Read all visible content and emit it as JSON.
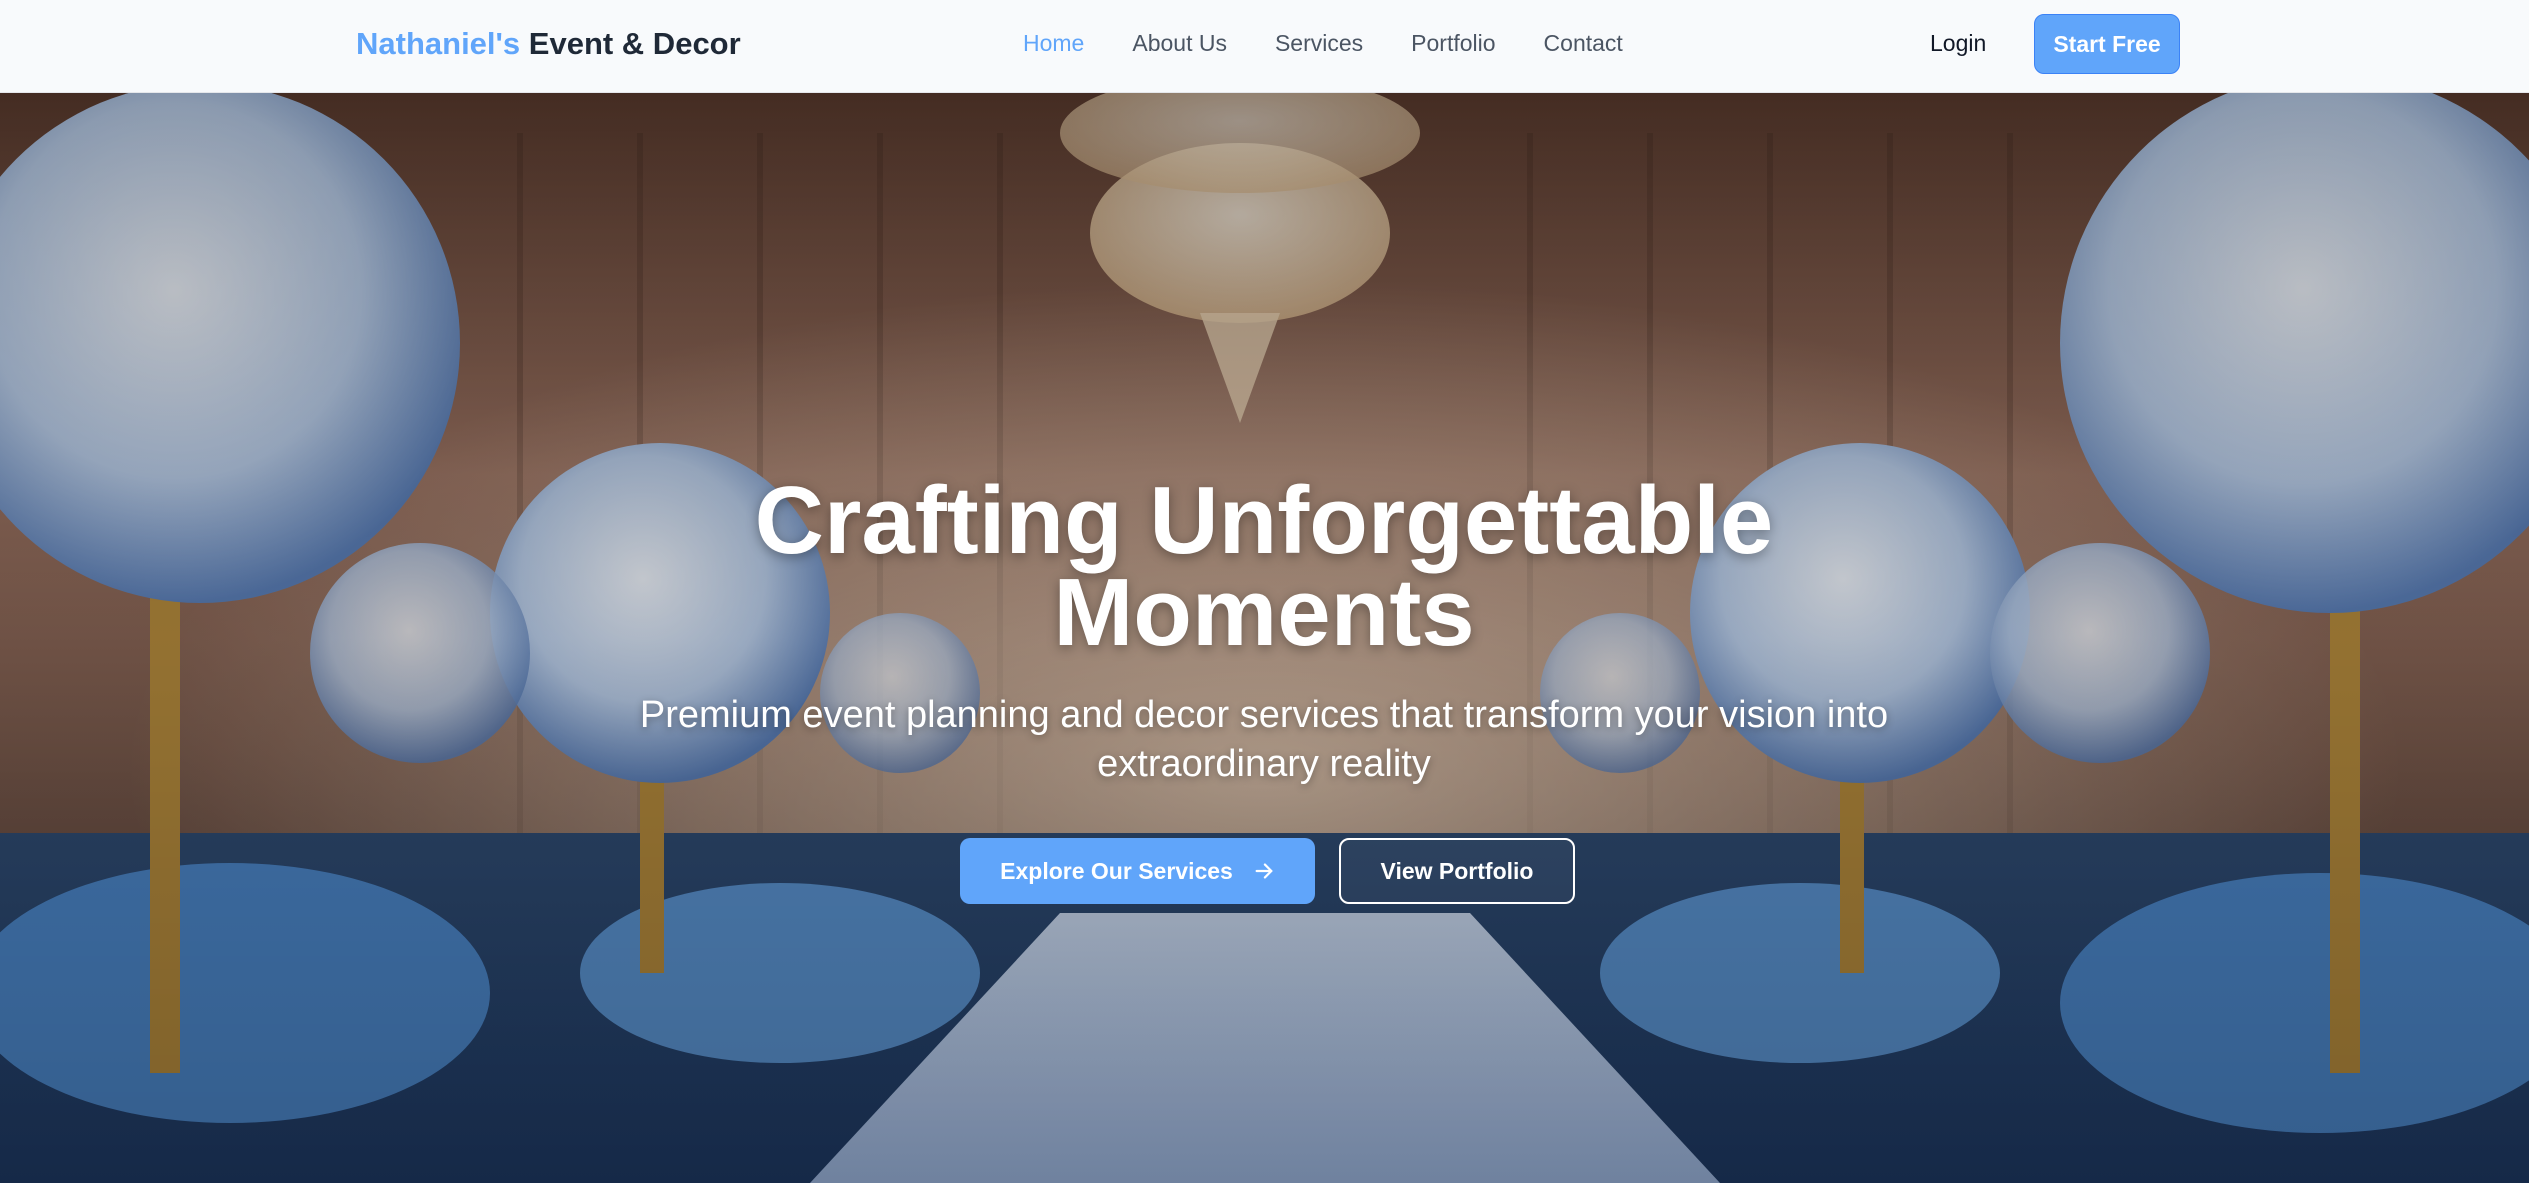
{
  "navbar": {
    "brand_accent": "Nathaniel's",
    "brand_rest": "Event & Decor",
    "links": [
      {
        "label": "Home",
        "active": true
      },
      {
        "label": "About Us"
      },
      {
        "label": "Services"
      },
      {
        "label": "Portfolio"
      },
      {
        "label": "Contact"
      }
    ],
    "login_label": "Login",
    "start_label": "Start Free"
  },
  "hero": {
    "title": "Crafting Unforgettable Moments",
    "subtitle": "Premium event planning and decor services that transform your vision into extraordinary reality",
    "primary_cta": "Explore Our Services",
    "primary_cta_icon": "arrow-right-icon",
    "secondary_cta": "View Portfolio"
  },
  "colors": {
    "accent": "#60a5fa",
    "nav_bg": "#f8fafc",
    "nav_text": "#4b5563",
    "hero_text": "#ffffff"
  }
}
